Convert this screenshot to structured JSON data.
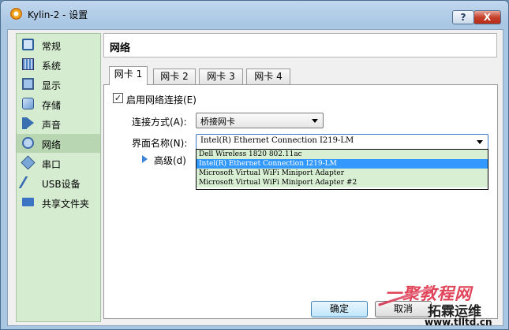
{
  "window": {
    "title": "Kylin-2 - 设置",
    "help_label": "?",
    "close_label": "X"
  },
  "sidebar": {
    "items": [
      {
        "label": "常规",
        "icon": "monitor-icon"
      },
      {
        "label": "系统",
        "icon": "motherboard-icon"
      },
      {
        "label": "显示",
        "icon": "display-icon"
      },
      {
        "label": "存储",
        "icon": "storage-icon"
      },
      {
        "label": "声音",
        "icon": "speaker-icon"
      },
      {
        "label": "网络",
        "icon": "network-icon",
        "selected": true
      },
      {
        "label": "串口",
        "icon": "serial-port-icon"
      },
      {
        "label": "USB设备",
        "icon": "usb-icon"
      },
      {
        "label": "共享文件夹",
        "icon": "folder-icon"
      }
    ]
  },
  "page": {
    "title": "网络"
  },
  "tabs": [
    {
      "label": "网卡 1",
      "active": true
    },
    {
      "label": "网卡 2"
    },
    {
      "label": "网卡 3"
    },
    {
      "label": "网卡 4"
    }
  ],
  "form": {
    "enable_label": "启用网络连接(E)",
    "enable_checked": true,
    "check_mark": "✓",
    "attach_label": "连接方式(A):",
    "attach_value": "桥接网卡",
    "name_label": "界面名称(N):",
    "name_value": "Intel(R) Ethernet Connection I219-LM",
    "advanced_label": "高级(d)"
  },
  "dropdown_options": [
    "Dell Wireless 1820 802.11ac",
    "Intel(R) Ethernet Connection I219-LM",
    "Microsoft Virtual WiFi Miniport Adapter",
    "Microsoft Virtual WiFi Miniport Adapter #2"
  ],
  "dropdown_selected_index": 1,
  "buttons": {
    "ok": "确定",
    "cancel": "取消"
  },
  "watermark": {
    "top": "一聚教程网",
    "mid": "拓霖运维",
    "url": "www.tlltd.cn"
  },
  "colors": {
    "sidebar_bg": "#d5ecd0",
    "selection": "#3399ff",
    "titlebar": "#a9c6e3"
  }
}
